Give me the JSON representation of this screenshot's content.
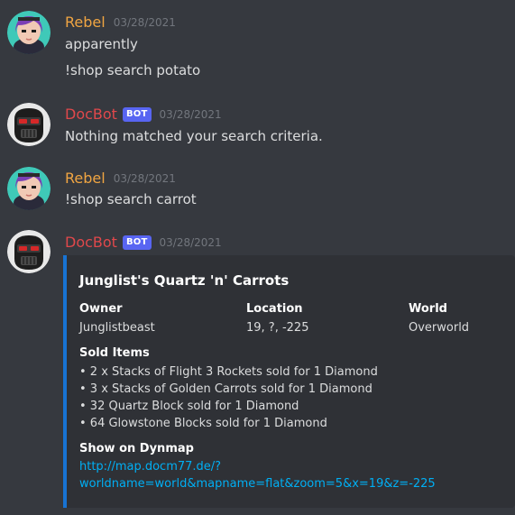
{
  "messages": [
    {
      "author": "Rebel",
      "timestamp": "03/28/2021",
      "lines": [
        "apparently",
        "!shop search potato"
      ],
      "avatar_icon": "anime-girl-avatar"
    },
    {
      "author": "DocBot",
      "badge": "BOT",
      "timestamp": "03/28/2021",
      "lines": [
        "Nothing matched your search criteria."
      ],
      "avatar_icon": "masked-robot-avatar"
    },
    {
      "author": "Rebel",
      "timestamp": "03/28/2021",
      "lines": [
        "!shop search carrot"
      ],
      "avatar_icon": "anime-girl-avatar"
    },
    {
      "author": "DocBot",
      "badge": "BOT",
      "timestamp": "03/28/2021",
      "avatar_icon": "masked-robot-avatar"
    }
  ],
  "embed": {
    "title": "Junglist's Quartz 'n' Carrots",
    "fields": [
      {
        "name": "Owner",
        "value": "Junglistbeast"
      },
      {
        "name": "Location",
        "value": "19, ?, -225"
      },
      {
        "name": "World",
        "value": "Overworld"
      }
    ],
    "sold_items": {
      "name": "Sold Items",
      "items": [
        "• 2 x Stacks of Flight 3 Rockets sold for 1 Diamond",
        "• 3 x Stacks of Golden Carrots sold for 1 Diamond",
        "• 32 Quartz Block sold for 1 Diamond",
        "• 64 Glowstone Blocks sold for 1 Diamond"
      ]
    },
    "dynmap": {
      "name": "Show on Dynmap",
      "link_lines": [
        "http://map.docm77.de/?",
        "worldname=world&mapname=flat&zoom=5&x=19&z=-225"
      ]
    }
  },
  "colors": {
    "background": "#36393f",
    "embed_background": "#2f3136",
    "embed_accent": "#1873d3",
    "rebel_name": "#f0a542",
    "docbot_name": "#e0484b",
    "bot_badge": "#5865f2",
    "link": "#00aff4"
  }
}
